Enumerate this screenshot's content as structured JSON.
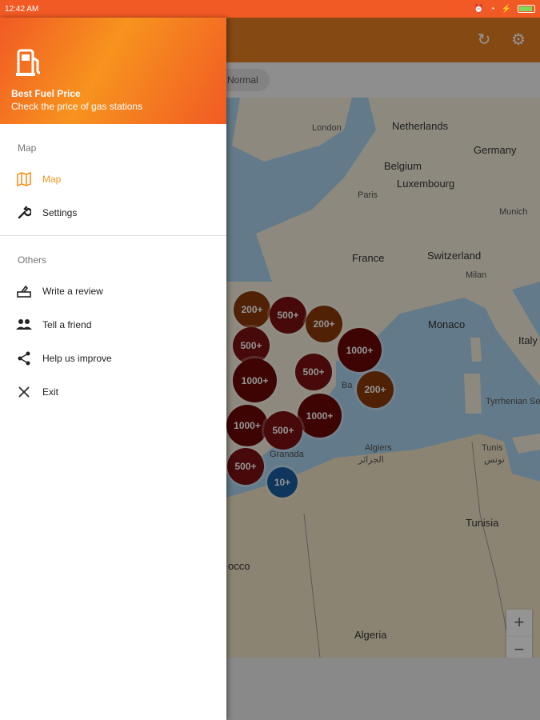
{
  "status_bar": {
    "time": "12:42 AM"
  },
  "chip": {
    "label": "Normal"
  },
  "drawer": {
    "title": "Best Fuel Price",
    "subtitle": "Check the price of gas stations",
    "sections": [
      {
        "label": "Map",
        "items": [
          {
            "label": "Map",
            "icon": "map-icon",
            "active": true
          },
          {
            "label": "Settings",
            "icon": "wrench-icon",
            "active": false
          }
        ]
      },
      {
        "label": "Others",
        "items": [
          {
            "label": "Write a review",
            "icon": "rate-review-icon",
            "active": false
          },
          {
            "label": "Tell a friend",
            "icon": "people-icon",
            "active": false
          },
          {
            "label": "Help us improve",
            "icon": "share-icon",
            "active": false
          },
          {
            "label": "Exit",
            "icon": "close-icon",
            "active": false
          }
        ]
      }
    ]
  },
  "map": {
    "places": [
      "London",
      "Netherlands",
      "Germany",
      "Belgium",
      "Luxembourg",
      "Paris",
      "Munich",
      "France",
      "Switzerland",
      "Milan",
      "Monaco",
      "Italy",
      "Tyrrhenian Sea",
      "Algiers",
      "الجزائر",
      "Tunis",
      "تونس",
      "Tunisia",
      "Algeria",
      "occo",
      "Ba",
      "Granada"
    ],
    "clusters": [
      "200+",
      "500+",
      "200+",
      "500+",
      "1000+",
      "500+",
      "1000+",
      "200+",
      "1000+",
      "1000+",
      "500+",
      "500+",
      "10+"
    ],
    "zoom_in": "+",
    "zoom_out": "−"
  },
  "colors": {
    "accent": "#f7931e",
    "status_bar": "#f15a24",
    "toolbar": "#e67e22",
    "cluster_200": "#8b3a0a",
    "cluster_500": "#7a1010",
    "cluster_1000": "#6b0808",
    "cluster_10": "#1a5fa0"
  }
}
